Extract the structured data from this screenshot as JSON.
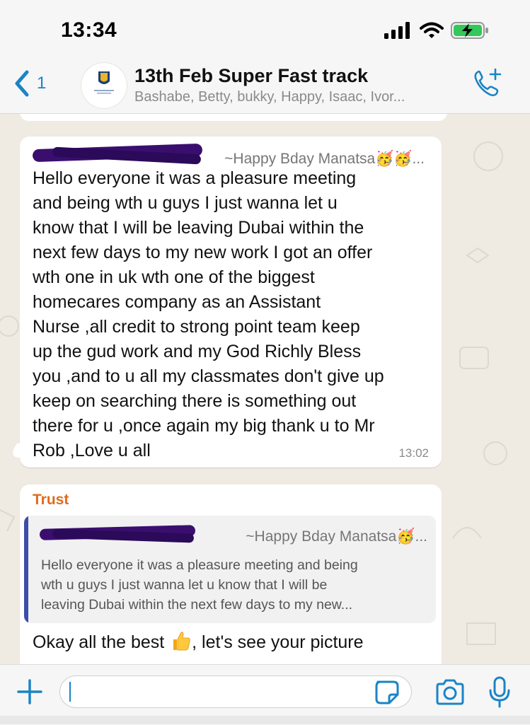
{
  "status_bar": {
    "time": "13:34",
    "icons": [
      "signal-icon",
      "wifi-icon",
      "battery-charging-icon"
    ]
  },
  "header": {
    "back_count": "1",
    "group_name": "13th Feb Super Fast track",
    "participants": "Bashabe, Betty, bukky, Happy, Isaac, Ivor...",
    "call_icon": "add-call-icon"
  },
  "messages": [
    {
      "sender_display": "~Happy Bday Manatsa🥳🥳...",
      "text": "Hello everyone  it was a pleasure  meeting\nand being  wth u guys  I just wanna  let u\nknow  that  I will be leaving  Dubai within the\nnext few  days to my new work I got  an offer\nwth one in uk wth one of  the biggest\nhomecares company as an Assistant\nNurse  ,all credit  to strong  point team  keep\nup the gud work and my God Richly Bless\nyou ,and to u all my classmates don't give up\nkeep  on searching  there is something  out\nthere  for  u ,once again my big thank u to Mr\nRob  ,Love u all",
      "time": "13:02"
    },
    {
      "author": "Trust",
      "quoted_sender": "~Happy Bday Manatsa🥳...",
      "quoted_text": "Hello everyone  it was a pleasure  meeting  and being\nwth u guys  I just wanna  let u know  that  I will be\nleaving  Dubai within the next few  days to my new...",
      "text_before_emoji": "Okay all the best ",
      "text_after_emoji": ", let's see your picture"
    }
  ],
  "input_bar": {
    "placeholder": "",
    "icons": [
      "plus-icon",
      "sticker-icon",
      "camera-icon",
      "microphone-icon"
    ]
  },
  "colors": {
    "accent_blue": "#1a84c6",
    "author_orange": "#e06c1d",
    "quote_bar": "#3b4fa8",
    "chat_background": "#efeae2",
    "battery_green": "#34c759"
  }
}
